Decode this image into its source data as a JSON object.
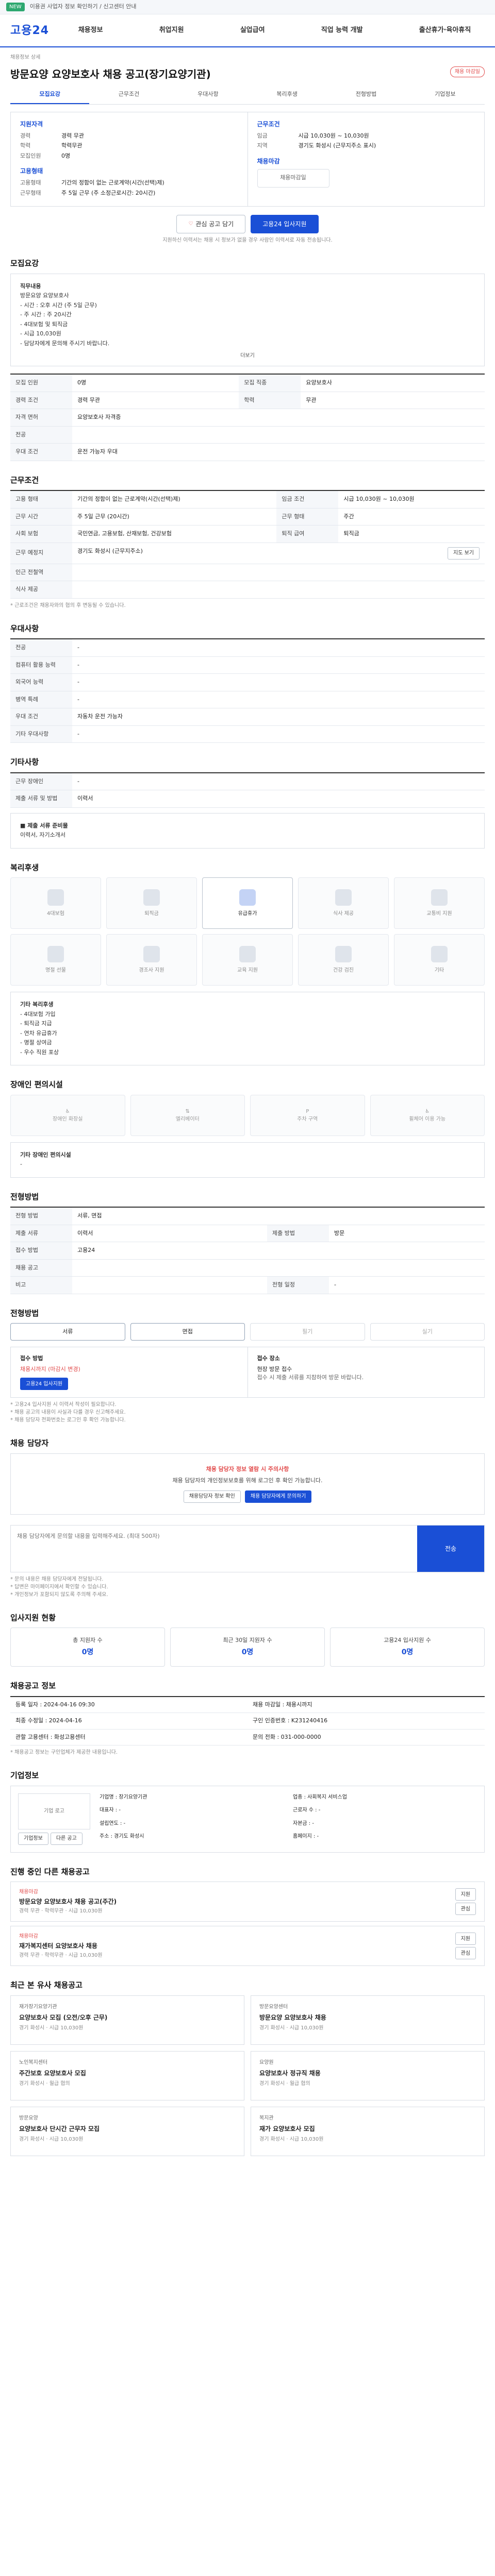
{
  "topbar": {
    "notice": "이용권 사업자 정보 확인하기 / 신고센터 안내",
    "badge": "NEW"
  },
  "gnb": {
    "logo": "고용24",
    "menu": [
      "채용정보",
      "취업지원",
      "실업급여",
      "직업 능력 개발",
      "출산휴가·육아휴직"
    ]
  },
  "job": {
    "breadcrumb": "채용정보 상세",
    "title": "방문요양 요양보호사 채용 공고(장기요양기관)",
    "status": "채용 마감일",
    "tabs": [
      "모집요강",
      "근무조건",
      "우대사항",
      "복리후생",
      "전형방법",
      "기업정보"
    ]
  },
  "summary": {
    "left_title": "지원자격",
    "left": [
      {
        "k": "경력",
        "v": "경력 무관"
      },
      {
        "k": "학력",
        "v": "학력무관"
      },
      {
        "k": "모집인원",
        "v": "0명"
      }
    ],
    "left_title2": "고용형태",
    "left2": [
      {
        "k": "고용형태",
        "v": "기간의 정함이 없는 근로계약(시간(선택)제)"
      },
      {
        "k": "근무형태",
        "v": "주 5일 근무 (주 소정근로시간: 20시간)"
      }
    ],
    "right_title": "근무조건",
    "right": [
      {
        "k": "임금",
        "v": "시급 10,030원 ~ 10,030원"
      },
      {
        "k": "지역",
        "v": "경기도 화성시 (근무지주소 표시)"
      }
    ],
    "right_title2": "채용마감",
    "logo_text": "채용마감일"
  },
  "actions": {
    "scrap": "관심 공고 담기",
    "apply": "고용24 입사지원",
    "note": "지원하신 이력서는 채용 시 정보가 없을 경우 사람인 이력서로 자동 전송됩니다."
  },
  "recruit": {
    "title": "모집요강",
    "body": [
      "직무내용",
      "방문요양 요양보호사",
      "- 시간 : 오후 시간 (주 5일 근무)",
      "- 주 시간 : 주 20시간",
      "- 4대보험 및 퇴직금",
      "- 시급 10,030원",
      "- 담당자에게 문의해 주시기 바랍니다."
    ],
    "more": "더보기"
  },
  "req_table": {
    "rows": [
      {
        "k": "모집 인원",
        "v": "0명",
        "k2": "모집 직종",
        "v2": "요양보호사"
      },
      {
        "k": "경력 조건",
        "v": "경력 무관",
        "k2": "학력",
        "v2": "무관"
      },
      {
        "k": "자격 면허",
        "v": "요양보호사 자격증",
        "k2": "",
        "v2": ""
      },
      {
        "k": "전공",
        "v": "",
        "k2": "",
        "v2": ""
      },
      {
        "k": "우대 조건",
        "v": "운전 가능자 우대",
        "k2": "",
        "v2": ""
      }
    ]
  },
  "cond": {
    "title": "근무조건",
    "rows": [
      {
        "k": "고용 형태",
        "v": "기간의 정함이 없는 근로계약(시간(선택)제)",
        "k2": "임금 조건",
        "v2": "시급 10,030원 ~ 10,030원"
      },
      {
        "k": "근무 시간",
        "v": "주 5일 근무 (20시간)",
        "k2": "근무 형태",
        "v2": "주간"
      },
      {
        "k": "사회 보험",
        "v": "국민연금, 고용보험, 산재보험, 건강보험",
        "k2": "퇴직 급여",
        "v2": "퇴직금"
      },
      {
        "k": "근무 예정지",
        "v": "경기도 화성시 (근무지주소)",
        "k2": "",
        "v2": ""
      },
      {
        "k": "인근 전철역",
        "v": "",
        "k2": "",
        "v2": ""
      },
      {
        "k": "식사 제공",
        "v": "",
        "k2": "",
        "v2": ""
      }
    ],
    "map_btn": "지도 보기",
    "caption": "* 근로조건은 채용자와의 협의 후 변동될 수 있습니다."
  },
  "pref": {
    "title": "우대사항",
    "rows": [
      {
        "k": "전공",
        "v": "-"
      },
      {
        "k": "컴퓨터 활용 능력",
        "v": "-"
      },
      {
        "k": "외국어 능력",
        "v": "-"
      },
      {
        "k": "병역 특례",
        "v": "-"
      },
      {
        "k": "우대 조건",
        "v": "자동차 운전 가능자"
      },
      {
        "k": "기타 우대사항",
        "v": "-"
      }
    ]
  },
  "etc": {
    "title": "기타사항",
    "rows": [
      {
        "k": "근무 장애인",
        "v": "-"
      },
      {
        "k": "제출 서류 및 방법",
        "v": "이력서"
      }
    ],
    "note_title": "■ 제출 서류 준비물",
    "note": "이력서, 자기소개서"
  },
  "welfare": {
    "title": "복리후생",
    "items": [
      {
        "label": "4대보험",
        "active": false
      },
      {
        "label": "퇴직금",
        "active": false
      },
      {
        "label": "유급휴가",
        "active": true
      },
      {
        "label": "식사 제공",
        "active": false
      },
      {
        "label": "교통비 지원",
        "active": false
      },
      {
        "label": "명절 선물",
        "active": false
      },
      {
        "label": "경조사 지원",
        "active": false
      },
      {
        "label": "교육 지원",
        "active": false
      },
      {
        "label": "건강 검진",
        "active": false
      },
      {
        "label": "기타",
        "active": false
      }
    ],
    "list_title": "기타 복리후생",
    "list": [
      "- 4대보험 가입",
      "- 퇴직금 지급",
      "- 연차 유급휴가",
      "- 명절 상여금",
      "- 우수 직원 포상"
    ]
  },
  "barrier": {
    "title": "장애인 편의시설",
    "items": [
      "장애인 화장실",
      "엘리베이터",
      "주차 구역",
      "휠체어 이용 가능"
    ],
    "list_title": "기타 장애인 편의시설",
    "list": "-"
  },
  "process": {
    "title": "전형방법",
    "rows": [
      {
        "k": "전형 방법",
        "v": "서류, 면접",
        "k2": "",
        "v2": ""
      },
      {
        "k": "제출 서류",
        "v": "이력서",
        "k2": "제출 방법",
        "v2": "방문"
      },
      {
        "k": "접수 방법",
        "v": "고용24",
        "k2": "",
        "v2": ""
      },
      {
        "k": "채용 공고",
        "v": "",
        "k2": "",
        "v2": ""
      },
      {
        "k": "비고",
        "v": "",
        "k2": "전형 일정",
        "v2": "-"
      }
    ]
  },
  "method": {
    "title": "전형방법",
    "items": [
      {
        "label": "서류",
        "active": true
      },
      {
        "label": "면접",
        "active": true
      },
      {
        "label": "필기",
        "active": false
      },
      {
        "label": "실기",
        "active": false
      }
    ]
  },
  "apply": {
    "left_lbl": "접수 방법",
    "left_v": "채용시까지 (마감시 변경)",
    "left_btn": "고용24 입사지원",
    "right_lbl": "접수 장소",
    "right_v": "현장 방문 접수",
    "right_v2": "접수 시 제출 서류를 지참하여 방문 바랍니다.",
    "notes": [
      "* 고용24 입사지원 시 이력서 작성이 필요합니다.",
      "* 채용 공고의 내용이 사실과 다를 경우 신고해주세요.",
      "* 채용 담당자 전화번호는 로그인 후 확인 가능합니다."
    ]
  },
  "recruiter": {
    "title": "채용 담당자",
    "hl": "채용 담당자 정보 열람 시 주의사항",
    "text": "채용 담당자의 개인정보보호를 위해 로그인 후 확인 가능합니다.",
    "btn1": "채용담당자 정보 확인",
    "btn2": "채용 담당자에게 문의하기"
  },
  "inquiry": {
    "placeholder": "채용 담당자에게 문의할 내용을 입력해주세요. (최대 500자)",
    "send": "전송",
    "notes": [
      "* 문의 내용은 채용 담당자에게 전달됩니다.",
      "* 답변은 마이페이지에서 확인할 수 있습니다.",
      "* 개인정보가 포함되지 않도록 주의해 주세요."
    ]
  },
  "stats": {
    "title": "입사지원 현황",
    "items": [
      {
        "label": "총 지원자 수",
        "value": "0명"
      },
      {
        "label": "최근 30일 지원자 수",
        "value": "0명"
      },
      {
        "label": "고용24 입사지원 수",
        "value": "0명"
      }
    ]
  },
  "info": {
    "title": "채용공고 정보",
    "cells": [
      "등록 일자 : 2024-04-16 09:30",
      "채용 마감일 : 채용시까지",
      "최종 수정일 : 2024-04-16",
      "구인 인증번호 : K231240416",
      "관할 고용센터 : 화성고용센터",
      "문의 전화 : 031-000-0000"
    ],
    "caption": "* 채용공고 정보는 구인업체가 제공한 내용입니다."
  },
  "company": {
    "title": "기업정보",
    "logo": "기업 로고",
    "rows": [
      "기업명 : 장기요양기관",
      "업종 : 사회복지 서비스업",
      "대표자 : -",
      "근로자 수 : -",
      "설립연도 : -",
      "자본금 : -",
      "주소 : 경기도 화성시",
      "홈페이지 : -"
    ],
    "btn1": "기업정보",
    "btn2": "다른 공고"
  },
  "jobs": {
    "title": "진행 중인 다른 채용공고",
    "items": [
      {
        "name": "채용마감",
        "title": "방문요양 요양보호사 채용 공고(주간)",
        "meta": "경력 무관 · 학력무관 · 시급 10,030원"
      },
      {
        "name": "채용마감",
        "title": "재가복지센터 요양보호사 채용",
        "meta": "경력 무관 · 학력무관 · 시급 10,030원"
      }
    ],
    "btn_apply": "지원",
    "btn_scrap": "관심"
  },
  "recommend": {
    "title": "최근 본 유사 채용공고",
    "cards": [
      {
        "co": "재가장기요양기관",
        "title": "요양보호사 모집 (오전/오후 근무)",
        "meta": "경기 화성시 · 시급 10,030원"
      },
      {
        "co": "방문요양센터",
        "title": "방문요양 요양보호사 채용",
        "meta": "경기 화성시 · 시급 10,030원"
      },
      {
        "co": "노인복지센터",
        "title": "주간보호 요양보호사 모집",
        "meta": "경기 화성시 · 월급 협의"
      },
      {
        "co": "요양원",
        "title": "요양보호사 정규직 채용",
        "meta": "경기 화성시 · 월급 협의"
      },
      {
        "co": "방문요양",
        "title": "요양보호사 단시간 근무자 모집",
        "meta": "경기 화성시 · 시급 10,030원"
      },
      {
        "co": "복지관",
        "title": "재가 요양보호사 모집",
        "meta": "경기 화성시 · 시급 10,030원"
      }
    ]
  }
}
